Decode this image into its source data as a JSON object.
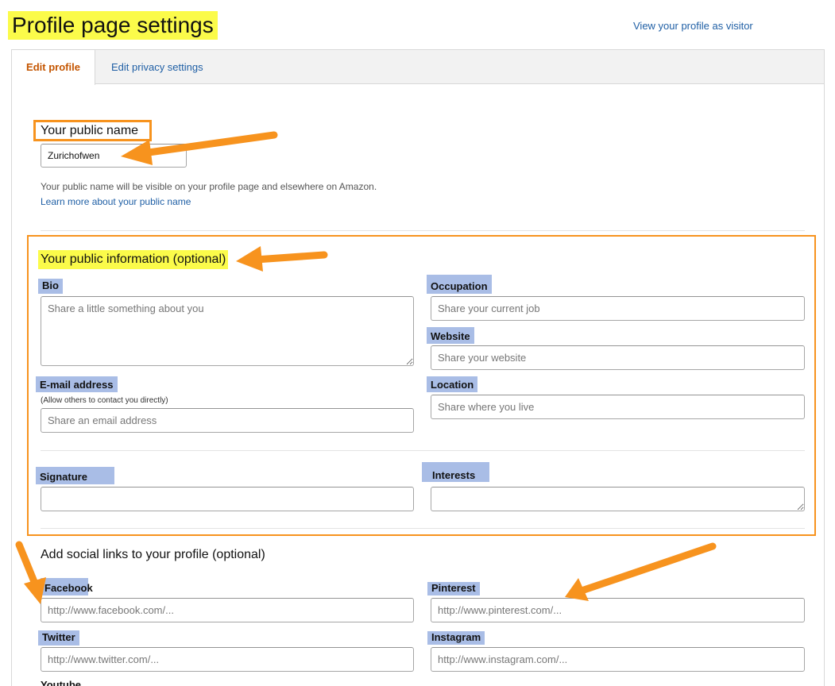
{
  "header": {
    "title": "Profile page settings",
    "visitor_link": "View your profile as visitor"
  },
  "tabs": [
    {
      "label": "Edit profile",
      "active": true
    },
    {
      "label": "Edit privacy settings",
      "active": false
    }
  ],
  "public_name": {
    "heading": "Your public name",
    "value": "Zurichofwen",
    "helper": "Your public name will be visible on your profile page and elsewhere on Amazon.",
    "learn_more": "Learn more about your public name"
  },
  "public_info": {
    "heading": "Your public information (optional)",
    "bio": {
      "label": "Bio",
      "placeholder": "Share a little something about you"
    },
    "occupation": {
      "label": "Occupation",
      "placeholder": "Share your current job"
    },
    "website": {
      "label": "Website",
      "placeholder": "Share your website"
    },
    "email": {
      "label": "E-mail address",
      "sublabel": "(Allow others to contact you directly)",
      "placeholder": "Share an email address"
    },
    "location": {
      "label": "Location",
      "placeholder": "Share where you live"
    },
    "signature": {
      "label": "Signature",
      "placeholder": ""
    },
    "interests": {
      "label": "Interests",
      "placeholder": ""
    }
  },
  "social": {
    "heading": "Add social links to your profile (optional)",
    "facebook": {
      "label": "Facebook",
      "placeholder": "http://www.facebook.com/..."
    },
    "pinterest": {
      "label": "Pinterest",
      "placeholder": "http://www.pinterest.com/..."
    },
    "twitter": {
      "label": "Twitter",
      "placeholder": "http://www.twitter.com/..."
    },
    "instagram": {
      "label": "Instagram",
      "placeholder": "http://www.instagram.com/..."
    },
    "youtube": {
      "label": "Youtube"
    }
  },
  "colors": {
    "accent_orange": "#f7931e",
    "highlight_yellow": "#fbfb4a",
    "label_blue": "#a9bde6",
    "link": "#1f5fa5",
    "active_tab": "#c45500"
  }
}
